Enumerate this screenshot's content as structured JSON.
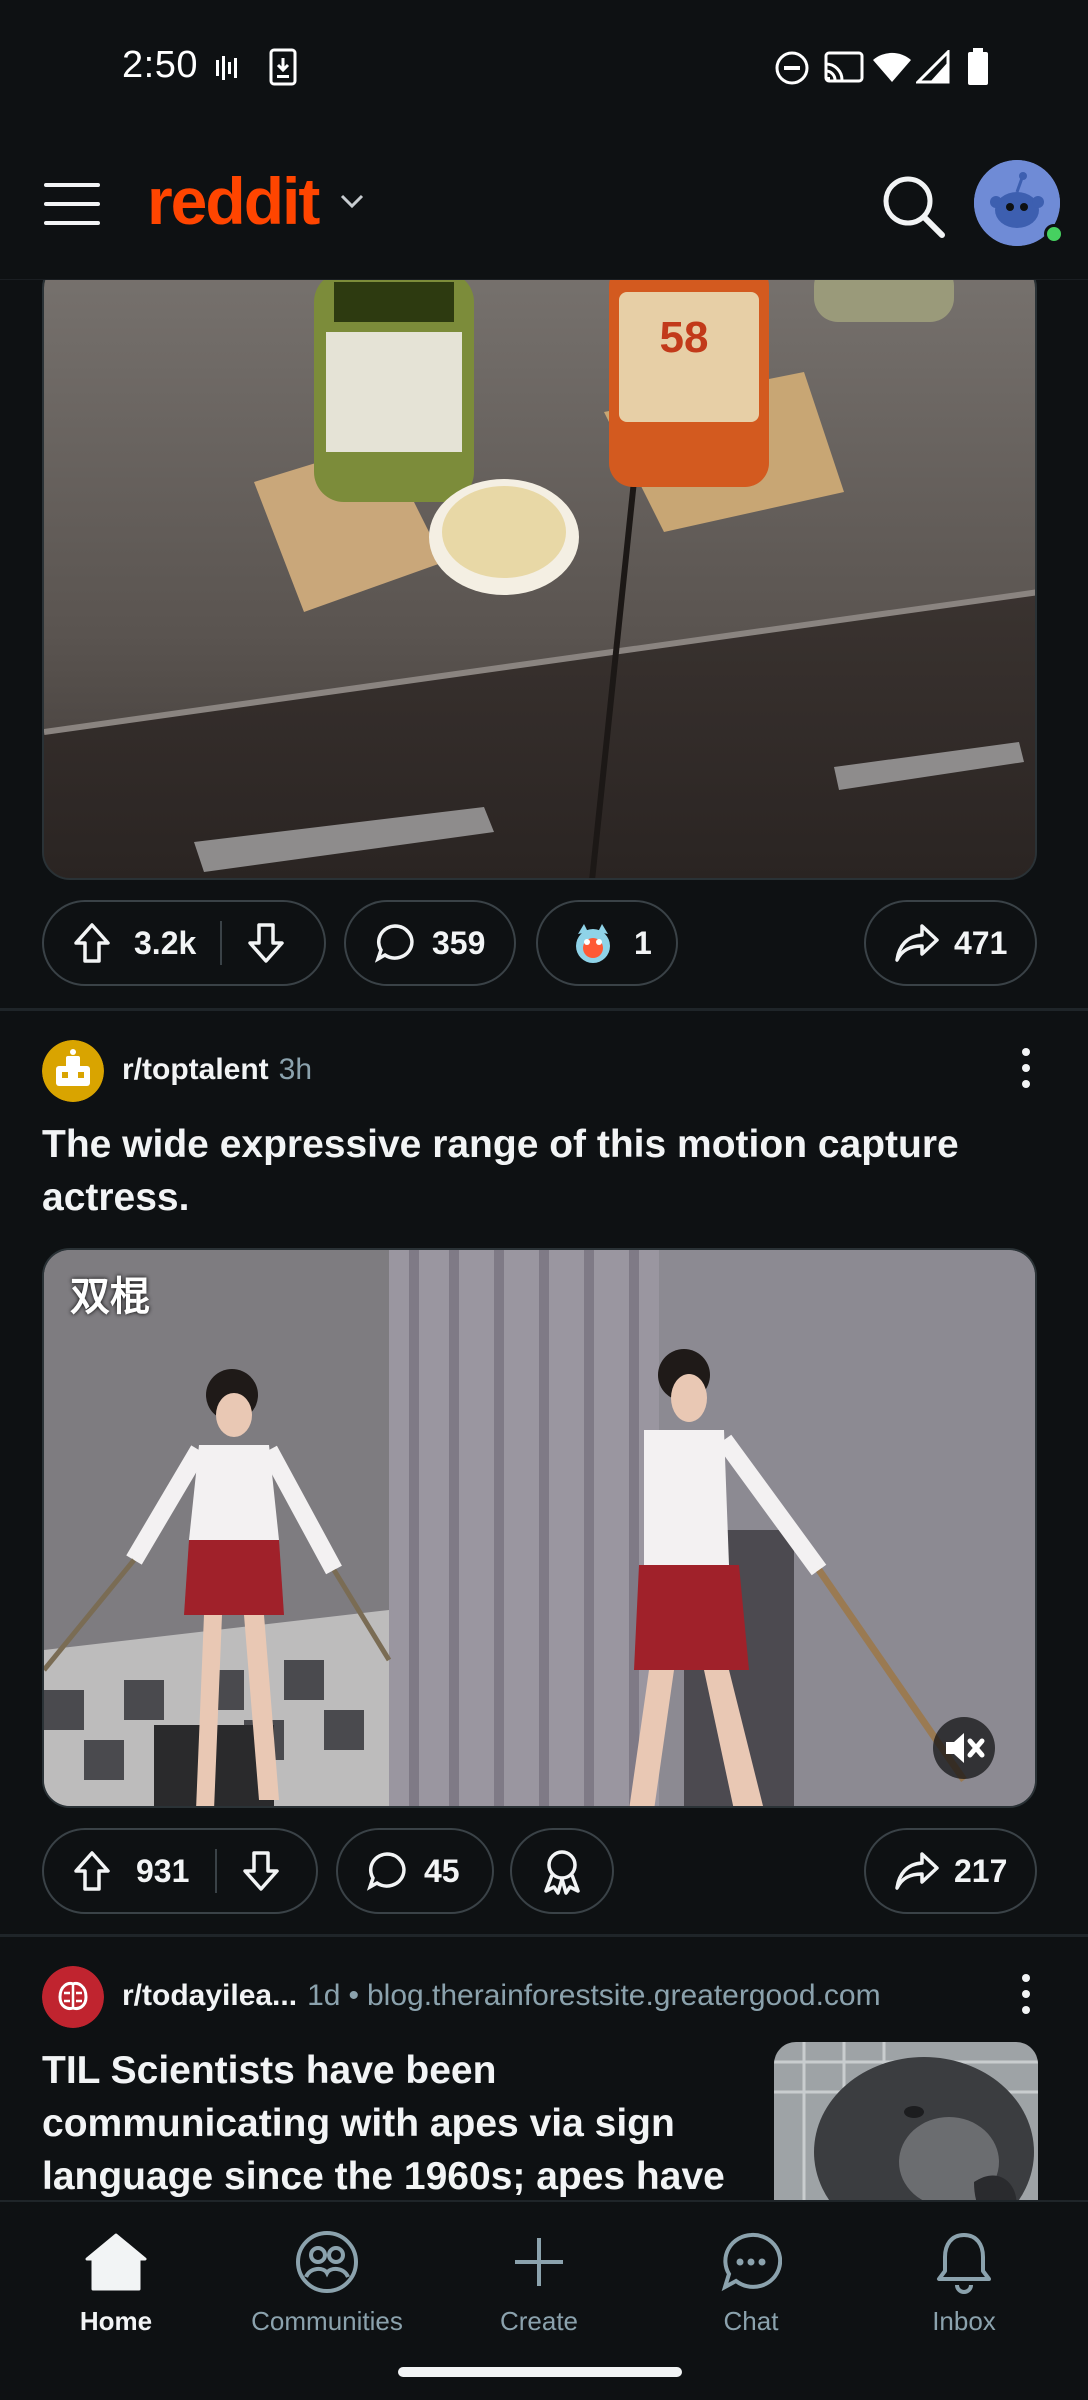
{
  "status_bar": {
    "time": "2:50"
  },
  "app_bar": {
    "logo_text": "reddit",
    "accent_color": "#ff4500"
  },
  "post1": {
    "upvotes": "3.2k",
    "comments": "359",
    "awards": "1",
    "shares": "471"
  },
  "post2": {
    "subreddit": "r/toptalent",
    "time": "3h",
    "title": "The wide expressive range of this motion capture actress.",
    "video_overlay_text": "双棍",
    "upvotes": "931",
    "comments": "45",
    "shares": "217"
  },
  "post3": {
    "subreddit": "r/todayilea...",
    "time": "1d",
    "domain": "blog.therainforestsite.greatergood.com",
    "title": "TIL Scientists have been communicating with apes via sign language since the 1960s; apes have"
  },
  "bottom_nav": {
    "items": [
      {
        "label": "Home",
        "icon": "home-icon"
      },
      {
        "label": "Communities",
        "icon": "communities-icon"
      },
      {
        "label": "Create",
        "icon": "plus-icon"
      },
      {
        "label": "Chat",
        "icon": "chat-icon"
      },
      {
        "label": "Inbox",
        "icon": "bell-icon"
      }
    ]
  }
}
